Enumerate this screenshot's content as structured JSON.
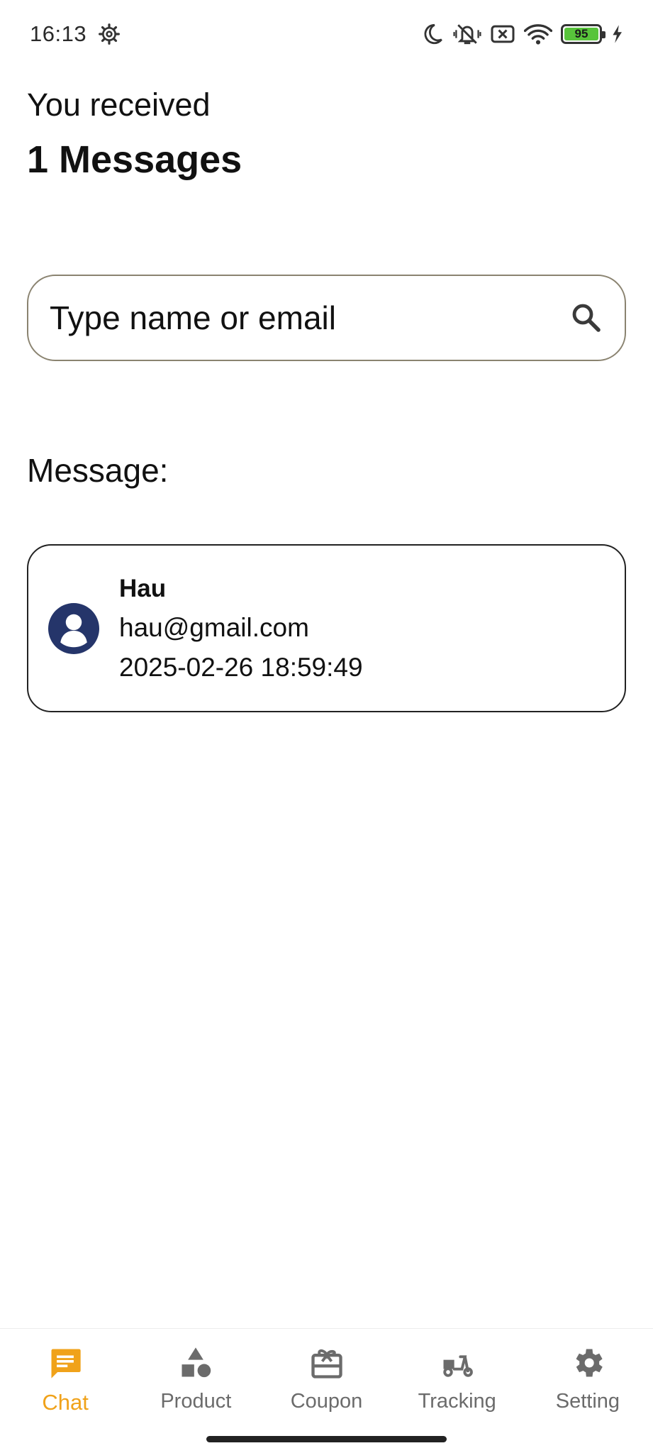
{
  "status_bar": {
    "time": "16:13",
    "battery_level": "95",
    "icons": [
      "settings-icon",
      "moon-icon",
      "vibrate-off-icon",
      "no-sim-icon",
      "wifi-icon",
      "battery-icon",
      "charging-icon"
    ]
  },
  "header": {
    "received_label": "You received",
    "count_label": "1 Messages"
  },
  "search": {
    "placeholder": "Type name or email",
    "value": ""
  },
  "section_label": "Message:",
  "messages": [
    {
      "name": "Hau",
      "email": "hau@gmail.com",
      "timestamp": "2025-02-26 18:59:49"
    }
  ],
  "bottom_nav": {
    "items": [
      {
        "label": "Chat",
        "icon": "chat-icon",
        "active": true
      },
      {
        "label": "Product",
        "icon": "category-icon",
        "active": false
      },
      {
        "label": "Coupon",
        "icon": "coupon-icon",
        "active": false
      },
      {
        "label": "Tracking",
        "icon": "scooter-icon",
        "active": false
      },
      {
        "label": "Setting",
        "icon": "gear-icon",
        "active": false
      }
    ]
  },
  "colors": {
    "accent": "#f0a21a",
    "avatar": "#25356a",
    "nav_inactive": "#6b6b6b",
    "battery": "#58c43b"
  }
}
